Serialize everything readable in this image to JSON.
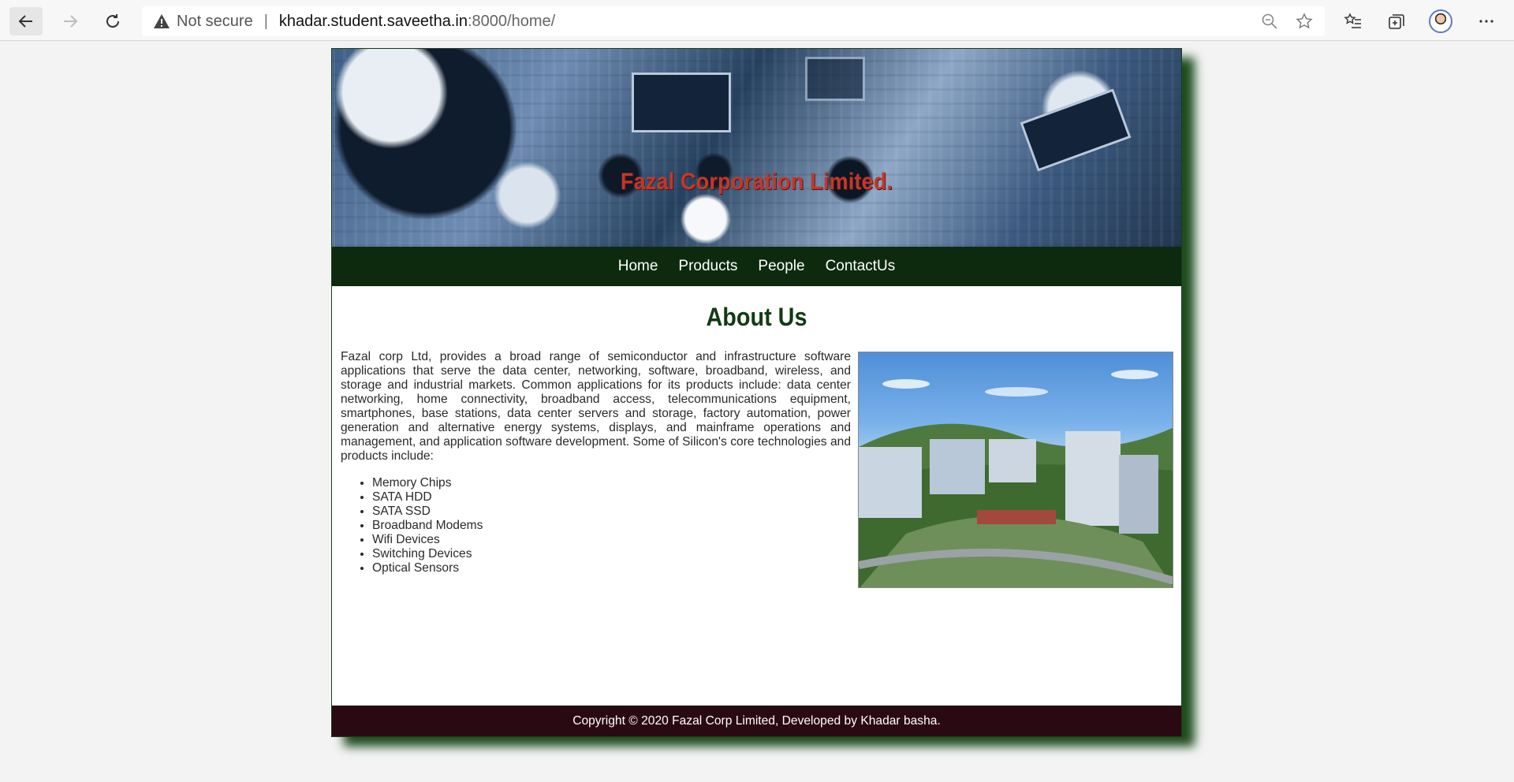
{
  "browser": {
    "not_secure": "Not secure",
    "url_host": "khadar.student.saveetha.in",
    "url_path": ":8000/home/"
  },
  "site": {
    "banner_title": "Fazal Corporation Limited.",
    "menu": [
      "Home",
      "Products",
      "People",
      "ContactUs"
    ],
    "section_title": "About Us",
    "about_text": "Fazal corp Ltd, provides a broad range of semiconductor and infrastructure software applications that serve the data center, networking, software, broadband, wireless, and storage and industrial markets. Common applications for its products include: data center networking, home connectivity, broadband access, telecommunications equipment, smartphones, base stations, data center servers and storage, factory automation, power generation and alternative energy systems, displays, and mainframe operations and management, and application software development. Some of Silicon's core technologies and products include:",
    "products": [
      "Memory Chips",
      "SATA HDD",
      "SATA SSD",
      "Broadband Modems",
      "Wifi Devices",
      "Switching Devices",
      "Optical Sensors"
    ],
    "footer": "Copyright © 2020 Fazal Corp Limited, Developed by Khadar basha."
  },
  "colors": {
    "menu_bg": "#0e2a0e",
    "footer_bg": "#2a0a12",
    "title_red": "#c0392b",
    "heading_green": "#123b12"
  }
}
